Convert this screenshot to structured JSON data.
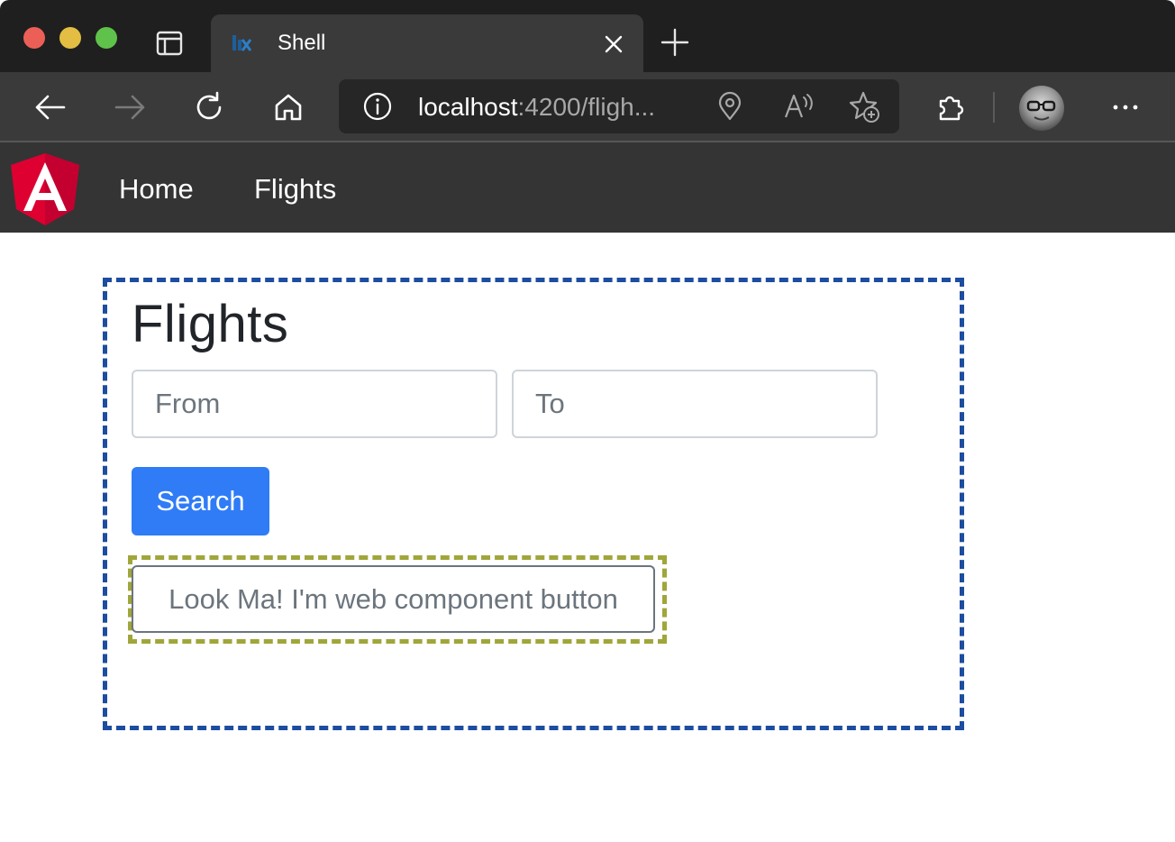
{
  "browser": {
    "tab": {
      "title": "Shell"
    },
    "address": {
      "host": "localhost",
      "path": ":4200/fligh..."
    },
    "icons": {
      "back": "arrow-left-icon",
      "forward": "arrow-right-icon",
      "reload": "reload-icon",
      "home": "home-icon",
      "info": "info-icon",
      "location": "location-pin-icon",
      "read_aloud": "read-aloud-icon",
      "favorites": "add-favorite-icon",
      "extensions": "puzzle-icon",
      "more": "more-dots-icon"
    }
  },
  "app_nav": {
    "logo": "angular-logo",
    "links": [
      "Home",
      "Flights"
    ]
  },
  "flights_page": {
    "title": "Flights",
    "from_placeholder": "From",
    "to_placeholder": "To",
    "from_value": "",
    "to_value": "",
    "search_label": "Search",
    "web_component_button_label": "Look Ma! I'm web component button"
  },
  "colors": {
    "mfe_frame_border": "#1c4d9f",
    "web_component_frame_border": "#a0a63a",
    "search_button": "#2f7cf6",
    "navbar": "#343434",
    "angular_red": "#c3002f"
  }
}
